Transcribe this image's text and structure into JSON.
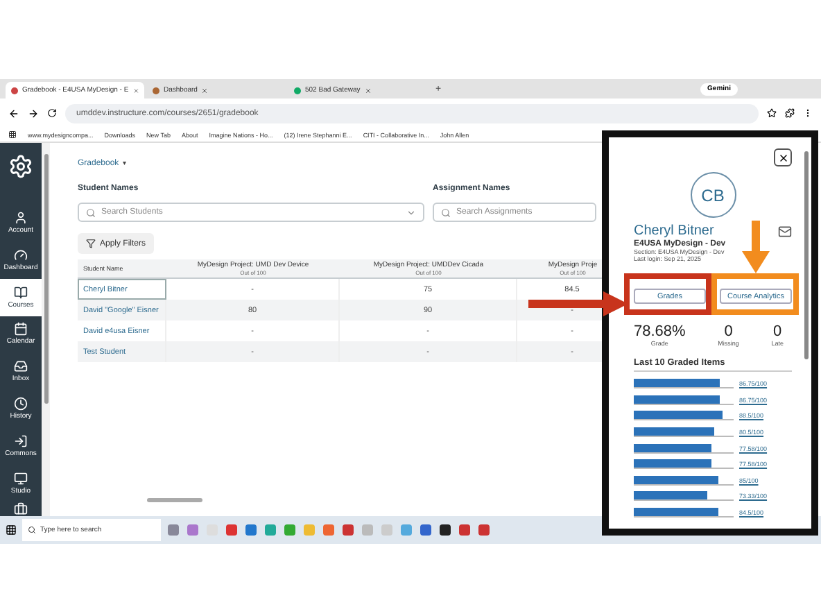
{
  "browser": {
    "tabs": [
      {
        "title": "Gradebook - E4USA MyDesign - E",
        "selected": true
      },
      {
        "title": "Dashboard",
        "selected": false
      },
      {
        "title": "502 Bad Gateway",
        "selected": false
      }
    ],
    "new_tab": "+",
    "gemini": "Gemini",
    "url": "umddev.instructure.com/courses/2651/gradebook",
    "bookmarks": [
      "www.mydesigncompa...",
      "Downloads",
      "New Tab",
      "About",
      "Imagine Nations - Ho...",
      "(12) Irene Stephanni E...",
      "CITI - Collaborative In...",
      "John Allen"
    ]
  },
  "nav": [
    {
      "label": "Account",
      "kind": "account",
      "selected": false
    },
    {
      "label": "Dashboard",
      "kind": "dashboard",
      "selected": false
    },
    {
      "label": "Courses",
      "kind": "courses",
      "selected": true
    },
    {
      "label": "Calendar",
      "kind": "calendar",
      "selected": false
    },
    {
      "label": "Inbox",
      "kind": "inbox",
      "selected": false
    },
    {
      "label": "History",
      "kind": "history",
      "selected": false
    },
    {
      "label": "Commons",
      "kind": "commons",
      "selected": false
    },
    {
      "label": "Studio",
      "kind": "studio",
      "selected": false
    }
  ],
  "gradebook": {
    "menu": "Gradebook",
    "menu_caret": "▾",
    "student_label": "Student Names",
    "student_placeholder": "Search Students",
    "assignment_label": "Assignment Names",
    "assignment_placeholder": "Search Assignments",
    "filters_button": "Apply Filters",
    "columns": [
      {
        "title": "Student Name"
      },
      {
        "title": "MyDesign Project: UMD Dev Device",
        "subtitle": "Out of 100"
      },
      {
        "title": "MyDesign Project: UMDDev Cicada",
        "subtitle": "Out of 100"
      },
      {
        "title": "MyDesign Proje",
        "subtitle": "Out of 100"
      }
    ],
    "rows": [
      {
        "student": "Cheryl Bitner",
        "selected": true,
        "grades": [
          "-",
          "75",
          "84.5"
        ]
      },
      {
        "student": "David \"Google\" Eisner",
        "selected": false,
        "grades": [
          "80",
          "90",
          "-"
        ]
      },
      {
        "student": "David e4usa Eisner",
        "selected": false,
        "grades": [
          "-",
          "-",
          "-"
        ]
      },
      {
        "student": "Test Student",
        "selected": false,
        "grades": [
          "-",
          "-",
          "-"
        ]
      }
    ]
  },
  "student_card": {
    "initials": "CB",
    "name": "Cheryl Bitner",
    "course": "E4USA MyDesign - Dev",
    "section": "Section: E4USA MyDesign - Dev",
    "last_login": "Last login: Sep 21, 2025",
    "buttons": [
      "Grades",
      "Course Analytics"
    ],
    "stats": [
      {
        "value": "78.68%",
        "label": "Grade"
      },
      {
        "value": "0",
        "label": "Missing"
      },
      {
        "value": "0",
        "label": "Late"
      }
    ],
    "graded_heading": "Last 10 Graded Items",
    "graded_items": [
      {
        "score": "86.75/100",
        "level": 0.8675
      },
      {
        "score": "86.75/100",
        "level": 0.8675
      },
      {
        "score": "88.5/100",
        "level": 0.885
      },
      {
        "score": "80.5/100",
        "level": 0.805
      },
      {
        "score": "77.58/100",
        "level": 0.7758
      },
      {
        "score": "77.58/100",
        "level": 0.7758
      },
      {
        "score": "85/100",
        "level": 0.85
      },
      {
        "score": "73.33/100",
        "level": 0.7333
      },
      {
        "score": "84.5/100",
        "level": 0.845
      }
    ]
  },
  "taskbar": {
    "search_placeholder": "Type here to search"
  }
}
